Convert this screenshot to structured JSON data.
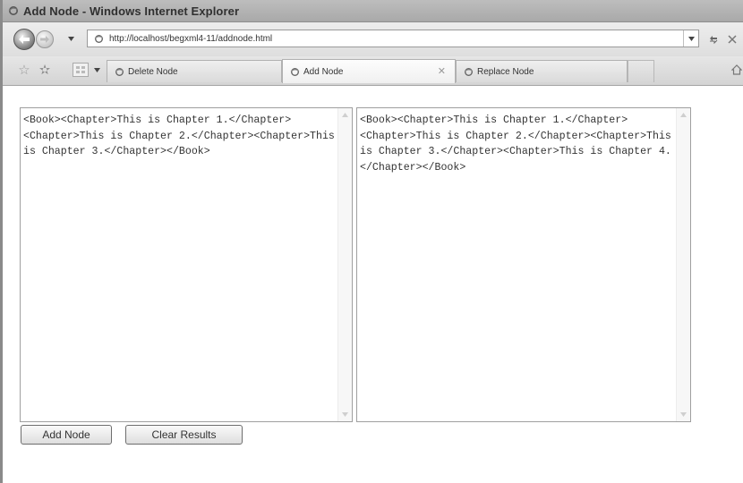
{
  "window": {
    "title": "Add Node - Windows Internet Explorer"
  },
  "address": {
    "url": "http://localhost/begxml4-11/addnode.html"
  },
  "tabs": [
    {
      "label": "Delete Node",
      "active": false
    },
    {
      "label": "Add Node",
      "active": true
    },
    {
      "label": "Replace Node",
      "active": false
    }
  ],
  "panes": {
    "original": "<Book><Chapter>This is Chapter 1.</Chapter><Chapter>This is Chapter 2.</Chapter><Chapter>This is Chapter 3.</Chapter></Book>",
    "result": "<Book><Chapter>This is Chapter 1.</Chapter><Chapter>This is Chapter 2.</Chapter><Chapter>This is Chapter 3.</Chapter><Chapter>This is Chapter 4.</Chapter></Book>"
  },
  "buttons": {
    "add_node": "Add Node",
    "clear_results": "Clear Results"
  },
  "icons": {
    "title": "ie-icon",
    "back": "back-arrow-icon",
    "forward": "forward-arrow-icon",
    "page": "page-icon",
    "refresh": "refresh-icon",
    "stop": "stop-icon",
    "favorites": "star-icon",
    "add_favorites": "add-star-icon",
    "quick_tabs": "quick-tabs-icon",
    "home": "home-icon"
  }
}
